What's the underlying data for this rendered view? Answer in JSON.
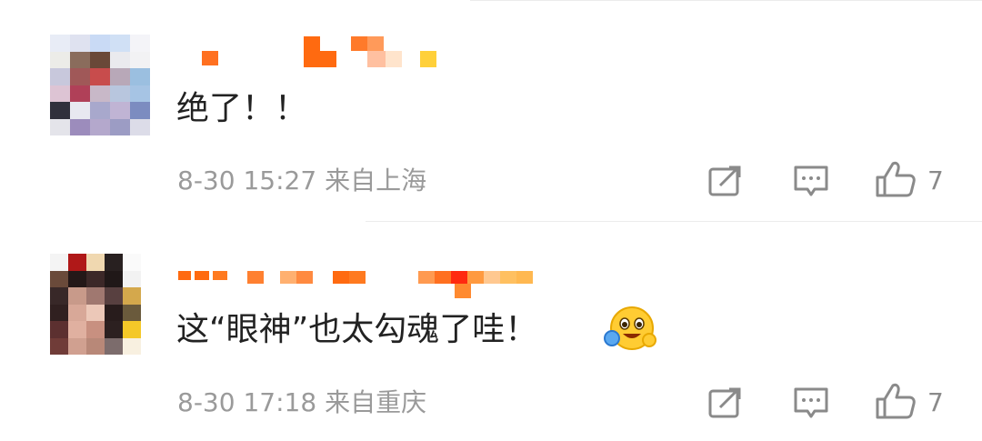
{
  "comments": [
    {
      "text": "绝了！！",
      "date": "8-30",
      "time": "15:27",
      "location": "来自上海",
      "likes": "7"
    },
    {
      "text": "这“眼神”也太勾魂了哇！",
      "emoji": "hug-face-icon",
      "date": "8-30",
      "time": "17:18",
      "location": "来自重庆",
      "likes": "7"
    }
  ],
  "colors": {
    "text": "#222222",
    "meta": "#9a9a9a",
    "icon": "#8a8a8a",
    "username_orange": "#ff7a1a",
    "divider": "#ececec"
  },
  "avatar1_cells": [
    "#e8ecf6",
    "#dfe2f0",
    "#c9daf5",
    "#d0e0f5",
    "#f4f4f8",
    "#ecece8",
    "#8a6c5c",
    "#6a4838",
    "#eaeaee",
    "#f2f2f4",
    "#c8c8dc",
    "#a05858",
    "#c84c4c",
    "#b8a8b8",
    "#9bbfe0",
    "#ddc4d4",
    "#b04058",
    "#c8b8c8",
    "#b8c6de",
    "#a6c4e4",
    "#30303c",
    "#e8e8f0",
    "#a8a8cc",
    "#c0b4d4",
    "#7c8cc0",
    "#e4e4ea",
    "#9c8cbc",
    "#b4a8cc",
    "#9c9cc4",
    "#dcdce8"
  ],
  "avatar2_cells": [
    "#f4f4f4",
    "#b01818",
    "#f0d8b0",
    "#282020",
    "#fafafa",
    "#6a4a3a",
    "#241818",
    "#3c2828",
    "#201818",
    "#f2f2f2",
    "#382828",
    "#c89a8a",
    "#a07870",
    "#584040",
    "#d4a84c",
    "#302020",
    "#d8a898",
    "#ecc8b8",
    "#281c1c",
    "#6a5a3c",
    "#5c3030",
    "#e0b0a0",
    "#c89080",
    "#2c2020",
    "#f4c828",
    "#703c38",
    "#d0a090",
    "#b88878",
    "#7c6c6c",
    "#f8f0e0"
  ]
}
